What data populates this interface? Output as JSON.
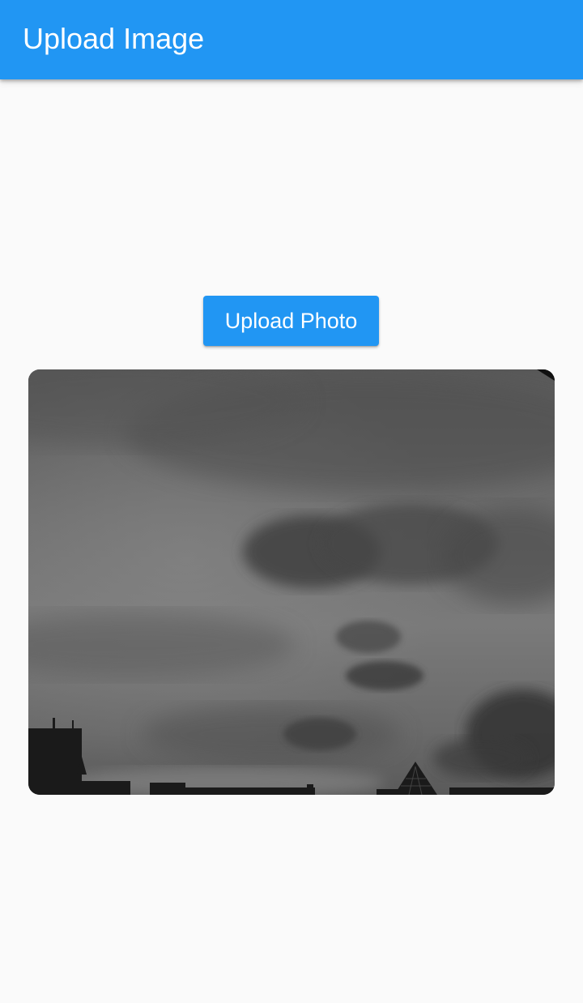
{
  "app_bar": {
    "title": "Upload Image",
    "color": "#2196f3"
  },
  "actions": {
    "upload_label": "Upload Photo"
  },
  "preview": {
    "icon": "photo-preview",
    "subject": "grayscale-cloudy-sky"
  }
}
